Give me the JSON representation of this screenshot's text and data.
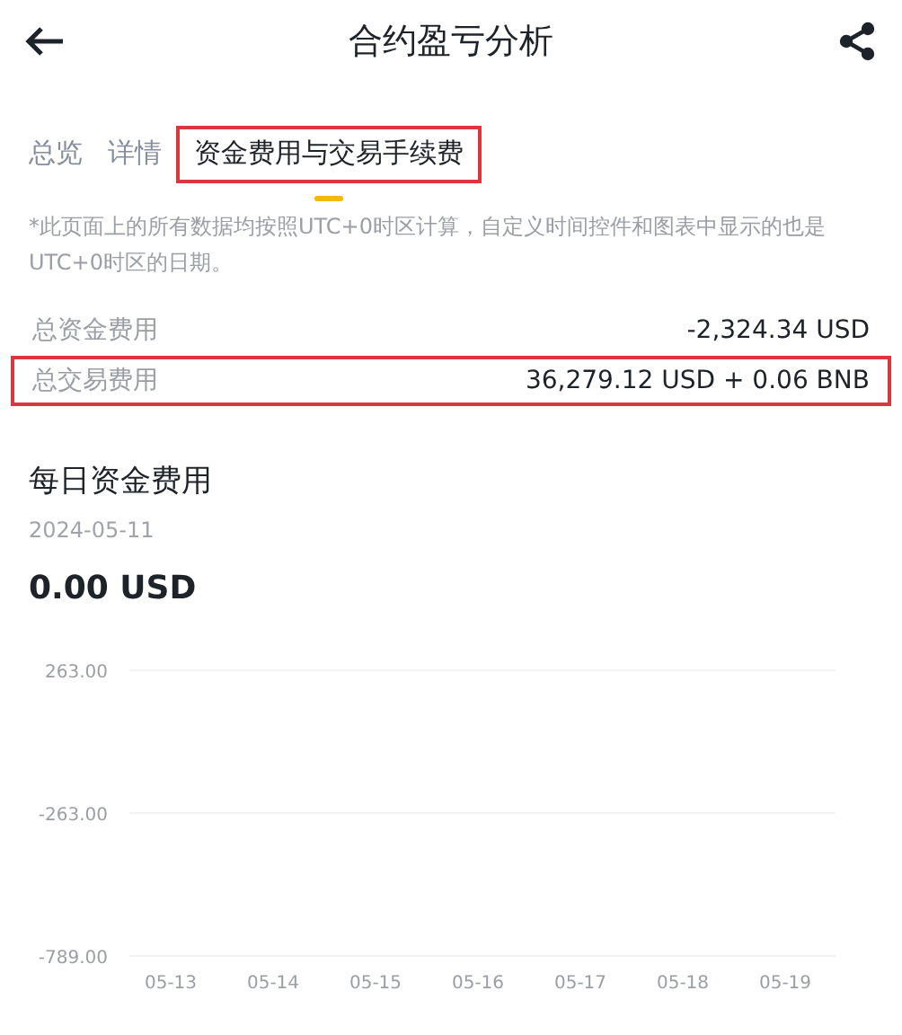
{
  "header": {
    "title": "合约盈亏分析"
  },
  "tabs": [
    {
      "label": "总览",
      "selected": false,
      "highlighted": false
    },
    {
      "label": "详情",
      "selected": false,
      "highlighted": false
    },
    {
      "label": "资金费用与交易手续费",
      "selected": true,
      "highlighted": true
    }
  ],
  "note": "*此页面上的所有数据均按照UTC+0时区计算，自定义时间控件和图表中显示的也是UTC+0时区的日期。",
  "summary": [
    {
      "label": "总资金费用",
      "value": "-2,324.34 USD",
      "highlighted": false
    },
    {
      "label": "总交易费用",
      "value": "36,279.12 USD + 0.06 BNB",
      "highlighted": true
    }
  ],
  "daily": {
    "title": "每日资金费用",
    "date": "2024-05-11",
    "amount": "0.00 USD",
    "chart_data": {
      "type": "bar",
      "categories": [
        "05-13",
        "05-14",
        "05-15",
        "05-16",
        "05-17",
        "05-18",
        "05-19"
      ],
      "series": [
        {
          "values": [
            null,
            null,
            null,
            null,
            null,
            null,
            null
          ]
        }
      ],
      "ylim": [
        -789,
        263
      ],
      "yticks": [
        {
          "value": 263,
          "label": "263.00"
        },
        {
          "value": -263,
          "label": "-263.00"
        },
        {
          "value": -789,
          "label": "-789.00"
        }
      ]
    }
  }
}
